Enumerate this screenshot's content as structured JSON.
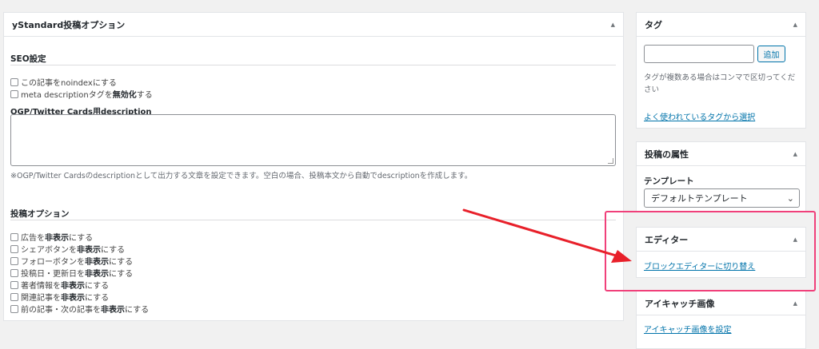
{
  "main_box": {
    "title": "yStandard投稿オプション",
    "seo": {
      "heading": "SEO設定",
      "noindex_label": "この記事をnoindexにする",
      "meta_desc_prefix": "meta descriptionタグを",
      "meta_desc_bold": "無効化",
      "meta_desc_suffix": "する",
      "ogp_label": "OGP/Twitter Cards用description",
      "ogp_value": "",
      "ogp_help": "※OGP/Twitter Cardsのdescriptionとして出力する文章を設定できます。空白の場合、投稿本文から自動でdescriptionを作成します。"
    },
    "post_options": {
      "heading": "投稿オプション",
      "items": [
        {
          "prefix": "広告を",
          "bold": "非表示",
          "suffix": "にする"
        },
        {
          "prefix": "シェアボタンを",
          "bold": "非表示",
          "suffix": "にする"
        },
        {
          "prefix": "フォローボタンを",
          "bold": "非表示",
          "suffix": "にする"
        },
        {
          "prefix": "投稿日・更新日を",
          "bold": "非表示",
          "suffix": "にする"
        },
        {
          "prefix": "著者情報を",
          "bold": "非表示",
          "suffix": "にする"
        },
        {
          "prefix": "関連記事を",
          "bold": "非表示",
          "suffix": "にする"
        },
        {
          "prefix": "前の記事・次の記事を",
          "bold": "非表示",
          "suffix": "にする"
        }
      ]
    }
  },
  "tags_box": {
    "title": "タグ",
    "input_value": "",
    "add_button": "追加",
    "help": "タグが複数ある場合はコンマで区切ってください",
    "popular_link": "よく使われているタグから選択"
  },
  "attributes_box": {
    "title": "投稿の属性",
    "template_label": "テンプレート",
    "template_selected": "デフォルトテンプレート"
  },
  "editor_box": {
    "title": "エディター",
    "switch_link": "ブロックエディターに切り替え"
  },
  "eyecatch_box": {
    "title": "アイキャッチ画像",
    "set_link": "アイキャッチ画像を設定"
  },
  "icons": {
    "collapse": "triangle-up-icon",
    "checkbox": "checkbox-unchecked",
    "select_arrow": "chevron-down-icon"
  },
  "colors": {
    "link": "#0073aa",
    "highlight": "#f0407a",
    "arrow": "#e8202a"
  }
}
